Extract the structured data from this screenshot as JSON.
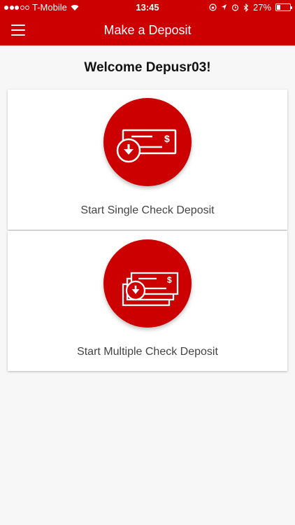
{
  "status_bar": {
    "carrier": "T-Mobile",
    "time": "13:45",
    "battery": "27%",
    "battery_level": 0.27
  },
  "nav": {
    "title": "Make a Deposit",
    "menu_icon": "hamburger-menu-icon"
  },
  "welcome": "Welcome Depusr03!",
  "actions": [
    {
      "label": "Start Single Check Deposit",
      "icon": "single-check-deposit-icon"
    },
    {
      "label": "Start Multiple Check Deposit",
      "icon": "multiple-check-deposit-icon"
    }
  ],
  "colors": {
    "brand_red": "#cc0000",
    "background": "#f7f7f7",
    "card": "#ffffff"
  }
}
